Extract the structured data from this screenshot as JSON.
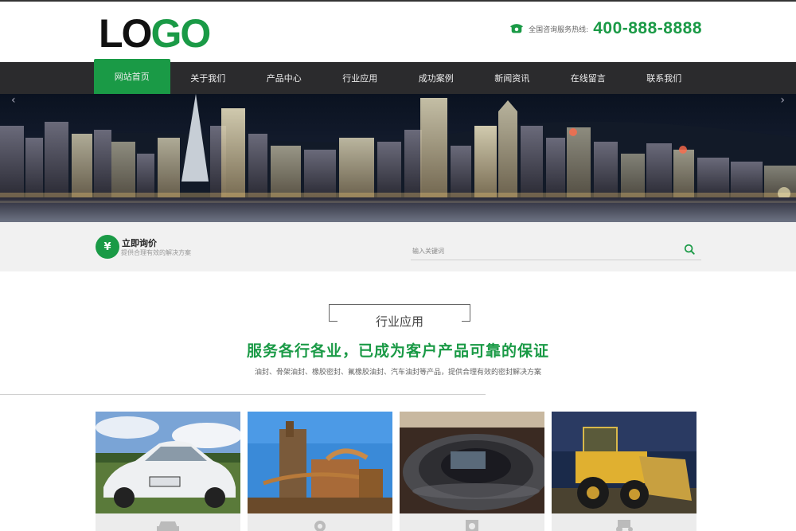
{
  "header": {
    "logo_left": "LO",
    "logo_right": "GO",
    "hotline_label": "全国咨询服务热线:",
    "hotline_number": "400-888-8888"
  },
  "nav": {
    "items": [
      {
        "label": "网站首页",
        "active": true
      },
      {
        "label": "关于我们",
        "active": false
      },
      {
        "label": "产品中心",
        "active": false
      },
      {
        "label": "行业应用",
        "active": false
      },
      {
        "label": "成功案例",
        "active": false
      },
      {
        "label": "新闻资讯",
        "active": false
      },
      {
        "label": "在线留言",
        "active": false
      },
      {
        "label": "联系我们",
        "active": false
      }
    ]
  },
  "inquiry": {
    "icon_symbol": "¥",
    "title": "立即询价",
    "subtitle": "提供合理有效的解决方案",
    "search_placeholder": "输入关键词"
  },
  "section": {
    "title": "行业应用",
    "heading": "服务各行各业，已成为客户产品可靠的保证",
    "description": "油封、骨架油封、橡胶密封、氟橡胶油封、汽车油封等产品，提供合理有效的密封解决方案"
  },
  "cards": [
    {
      "icon": "car-icon"
    },
    {
      "icon": "gear-icon"
    },
    {
      "icon": "washer-icon"
    },
    {
      "icon": "tractor-icon"
    }
  ],
  "colors": {
    "brand_green": "#1a9a46",
    "nav_bg": "#2b2b2d"
  }
}
